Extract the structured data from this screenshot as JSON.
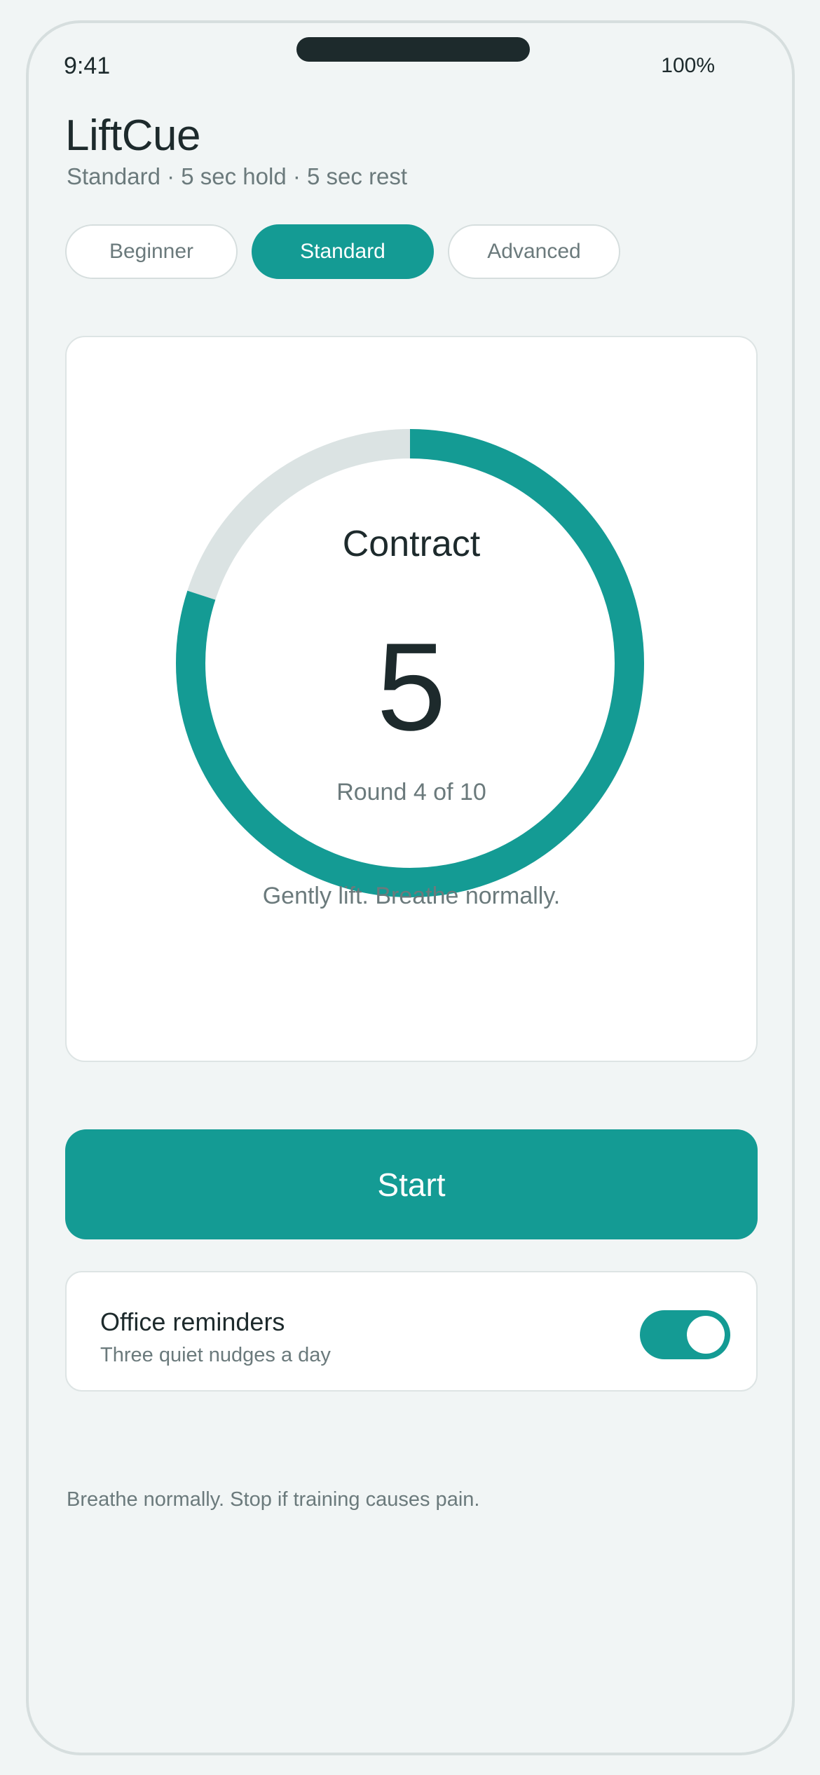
{
  "status_bar": {
    "time": "9:41",
    "battery": "100%"
  },
  "header": {
    "title": "LiftCue",
    "subtitle": "Standard · 5 sec hold · 5 sec rest"
  },
  "levels": {
    "tabs": [
      {
        "label": "Beginner",
        "selected": false
      },
      {
        "label": "Standard",
        "selected": true
      },
      {
        "label": "Advanced",
        "selected": false
      }
    ]
  },
  "timer": {
    "phase": "Contract",
    "countdown": "5",
    "round_text": "Round 4 of 10",
    "cue": "Gently lift. Breathe normally.",
    "progress_fraction": 0.8,
    "progress_color": "#149b94",
    "track_color": "#dbe3e3"
  },
  "actions": {
    "start_label": "Start"
  },
  "reminders": {
    "title": "Office reminders",
    "subtitle": "Three quiet nudges a day",
    "enabled": true
  },
  "footer": {
    "note": "Breathe normally. Stop if training causes pain."
  },
  "colors": {
    "accent": "#149b94",
    "background": "#f1f5f5",
    "text_primary": "#1d2a2c",
    "text_secondary": "#6b7a7c"
  }
}
